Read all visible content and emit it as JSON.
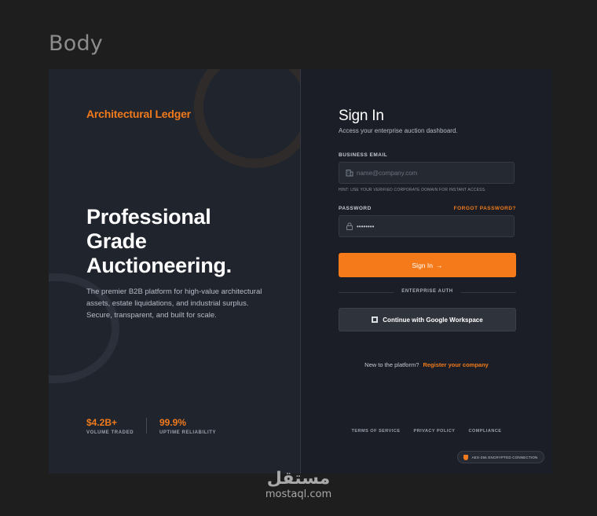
{
  "frame": {
    "label": "Body"
  },
  "brand": {
    "name": "Architectural Ledger",
    "accent": "#f07a1c"
  },
  "hero": {
    "title_lines": [
      "Professional",
      "Grade",
      "Auctioneering."
    ],
    "description": "The premier B2B platform for high-value architectural assets, estate liquidations, and industrial surplus. Secure, transparent, and built for scale."
  },
  "stats": [
    {
      "value": "$4.2B+",
      "label": "VOLUME TRADED"
    },
    {
      "value": "99.9%",
      "label": "UPTIME RELIABILITY"
    }
  ],
  "signin": {
    "title": "Sign In",
    "subtitle": "Access your enterprise auction dashboard.",
    "email": {
      "label": "BUSINESS EMAIL",
      "placeholder": "name@company.com",
      "value": "",
      "hint": "HINT: USE YOUR VERIFIED CORPORATE DOMAIN FOR INSTANT ACCESS.",
      "icon": "building-icon"
    },
    "password": {
      "label": "PASSWORD",
      "forgot": "FORGOT PASSWORD?",
      "value": "••••••••",
      "icon": "lock-icon"
    },
    "submit_label": "Sign In",
    "submit_icon": "arrow-right-icon",
    "divider_text": "ENTERPRISE AUTH",
    "google_label": "Continue with Google Workspace",
    "register_prompt": "New to the platform?",
    "register_link": "Register your company"
  },
  "footer": {
    "links": [
      "TERMS OF SERVICE",
      "PRIVACY POLICY",
      "COMPLIANCE"
    ],
    "badge": "AES-256 ENCRYPTED CONNECTION"
  },
  "watermark": {
    "arabic": "مستقل",
    "latin": "mostaql.com"
  },
  "colors": {
    "primary_button": "#f57a1a",
    "background": "#1e1e1e",
    "panel": "#20242d"
  }
}
